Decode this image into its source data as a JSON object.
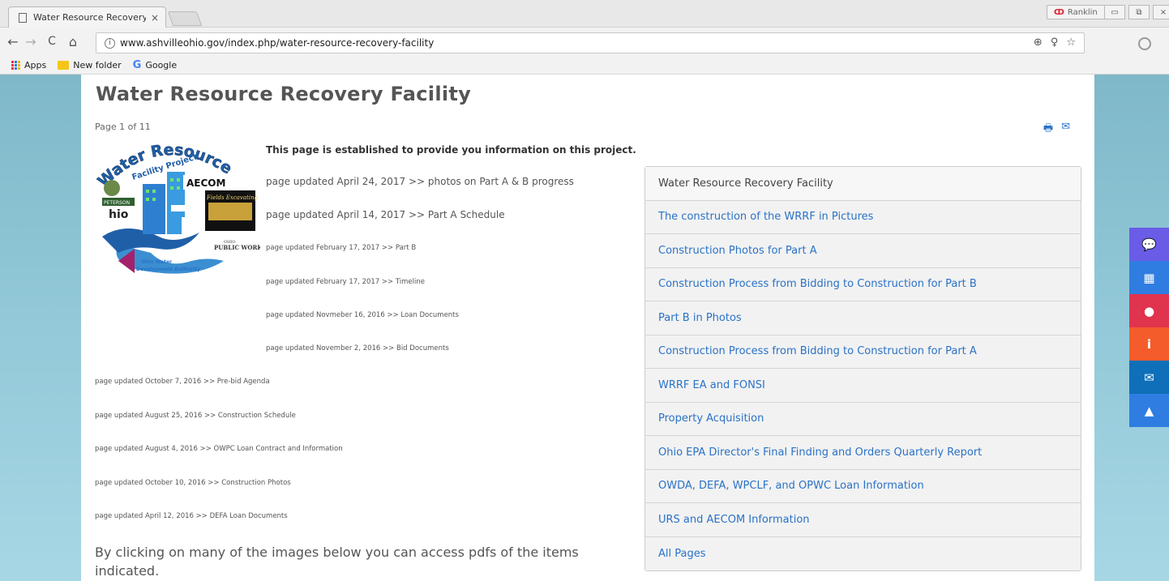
{
  "browser": {
    "tab_title": "Water Resource Recovery",
    "tab_close": "×",
    "profile_name": "Ranklin",
    "profile_icon": "ↀ",
    "url": "www.ashvilleohio.gov/index.php/water-resource-recovery-facility",
    "nav": {
      "back": "←",
      "forward": "→",
      "reload": "C",
      "home": "⌂"
    },
    "info_icon": "i",
    "omnibox_icons": [
      "⊕",
      "♀",
      "☆"
    ],
    "window_buttons": [
      "▭",
      "⧉",
      "×"
    ]
  },
  "bookmarks": [
    {
      "label": "Apps",
      "icon": "apps-icon"
    },
    {
      "label": "New folder",
      "icon": "folder-icon"
    },
    {
      "label": "Google",
      "icon": "google-icon"
    }
  ],
  "google_glyph": "G",
  "page": {
    "title": "Water Resource Recovery Facility",
    "pager": "Page 1 of 11",
    "print_icon": "🖶",
    "email_icon": "✉",
    "intro": "This page is established to provide you information on this project.",
    "updates": [
      "page updated April 24, 2017 >> photos on Part A & B progress",
      "page updated April 14, 2017 >> Part A Schedule",
      "page updated February 17, 2017 >> Part B",
      "page updated February 17, 2017 >> Timeline",
      "page updated Novmeber 16, 2016 >> Loan Documents",
      "page updated November 2, 2016 >> Bid Documents",
      "page updated October 7, 2016 >> Pre-bid Agenda",
      "page updated August 25, 2016 >> Construction Schedule",
      "page updated August 4, 2016 >> OWPC Loan Contract and Information",
      "page updated October 10, 2016 >> Construction Photos",
      "page updated April 12, 2016 >> DEFA Loan Documents"
    ],
    "bottom_text": "By clicking on many of the images below you can access pdfs of the items indicated.",
    "logo": {
      "arc_text": "Water Resource Recovery",
      "sub_arc": "Facility Project",
      "aecom": "AECOM",
      "peterson": "PETERSON",
      "ohio": "hio",
      "fields": "Fields Excavating",
      "opw_line1": "OHIO",
      "opw_line2": "PUBLIC WORKS",
      "owda_line1": "Ohio Water",
      "owda_line2": "Development Authority"
    }
  },
  "sidebar": {
    "items": [
      {
        "label": "Water Resource Recovery Facility",
        "active": true
      },
      {
        "label": "The construction of the WRRF in Pictures"
      },
      {
        "label": "Construction Photos for Part A"
      },
      {
        "label": "Construction Process from Bidding to Construction for Part B"
      },
      {
        "label": "Part B in Photos"
      },
      {
        "label": "Construction Process from Bidding to Construction for Part A"
      },
      {
        "label": "WRRF EA and FONSI"
      },
      {
        "label": "Property Acquisition"
      },
      {
        "label": "Ohio EPA Director's Final Finding and Orders Quarterly Report"
      },
      {
        "label": "OWDA, DEFA, WPCLF, and OPWC Loan Information"
      },
      {
        "label": "URS and AECOM Information"
      },
      {
        "label": "All Pages"
      }
    ]
  },
  "floating_buttons": [
    {
      "icon": "chat-icon",
      "glyph": "💬",
      "color": "#6b5ce7"
    },
    {
      "icon": "calendar-icon",
      "glyph": "▦",
      "color": "#2f7de1"
    },
    {
      "icon": "globe-icon",
      "glyph": "●",
      "color": "#e0334d"
    },
    {
      "icon": "info-icon",
      "glyph": "i",
      "color": "#f45d2b"
    },
    {
      "icon": "mail-icon",
      "glyph": "✉",
      "color": "#0f6fb8"
    },
    {
      "icon": "alert-icon",
      "glyph": "▲",
      "color": "#2f7de1"
    }
  ],
  "colors": {
    "link": "#2a72c7",
    "title": "#555555",
    "background_gradient_top": "#7fb8c9",
    "background_gradient_bottom": "#a7d7e5"
  }
}
